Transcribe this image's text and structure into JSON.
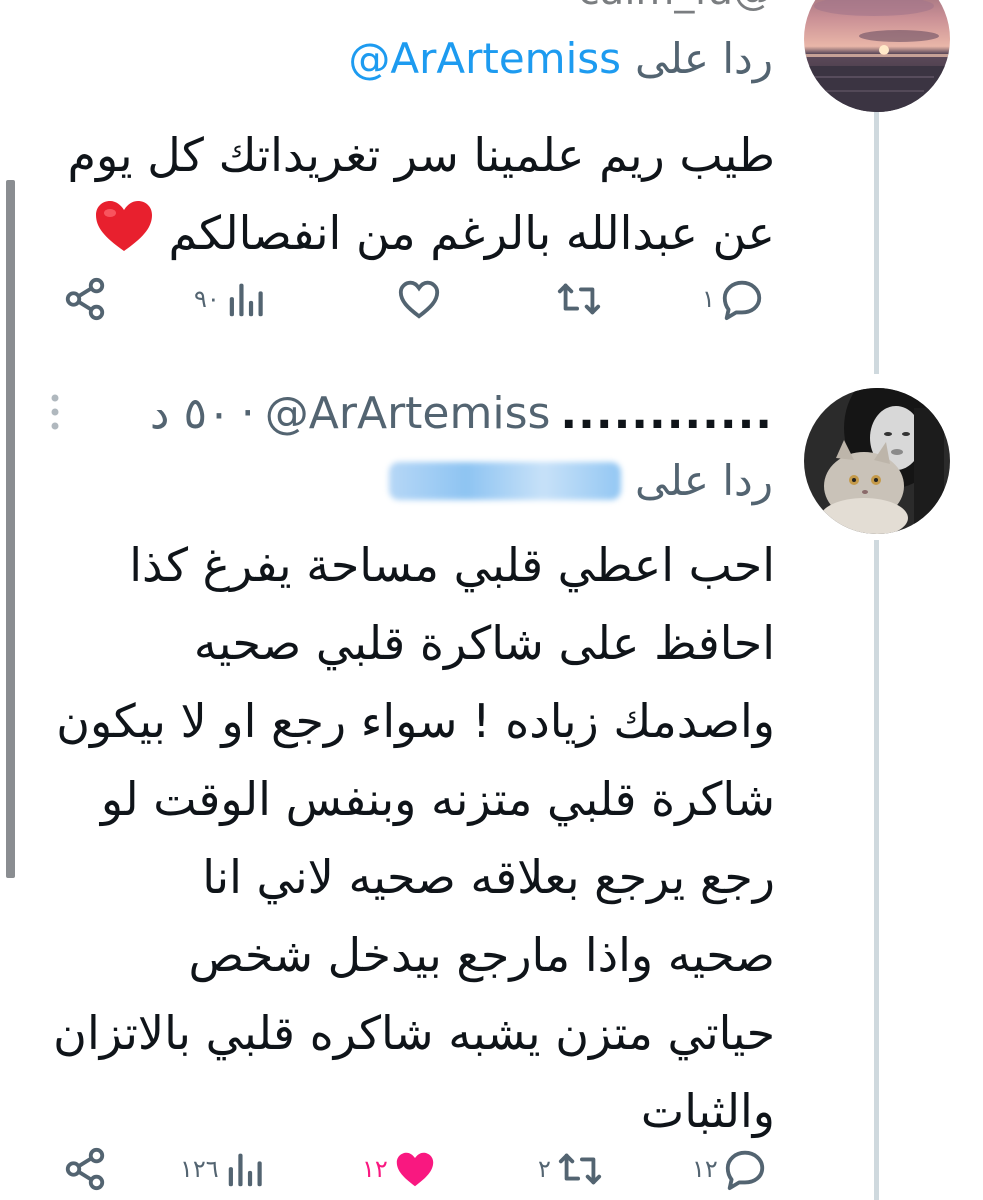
{
  "tweet1": {
    "previous_handle": "@calm_fa",
    "reply_prefix": "ردا على",
    "reply_handle": "@ArArtemiss",
    "body_lines": [
      "طيب ريم علمينا سر تغريداتك كل يوم",
      "عن عبدالله بالرغم من انفصالكم"
    ],
    "emoji": "red-heart-emoji",
    "actions": {
      "reply_count": "١",
      "retweet_count": "",
      "like_count": "",
      "views_count": "٩٠",
      "icons": [
        "reply-icon",
        "retweet-icon",
        "like-icon",
        "views-icon",
        "share-icon"
      ]
    }
  },
  "tweet2": {
    "display_name": "............",
    "handle": "@ArArtemiss",
    "separator": "·",
    "time": "٥٠ د",
    "reply_prefix": "ردا على",
    "reply_handle_blurred": true,
    "body_lines": [
      "احب اعطي قلبي مساحة يفرغ كذا",
      "احافظ على شاكرة قلبي صحيه",
      "واصدمك زياده ! سواء رجع او لا بيكون",
      "شاكرة قلبي متزنه وبنفس الوقت لو",
      "رجع يرجع بعلاقه صحيه لاني انا",
      "صحيه واذا مارجع بيدخل شخص",
      "حياتي متزن يشبه شاكره قلبي بالاتزان",
      "والثبات"
    ],
    "actions": {
      "reply_count": "١٢",
      "retweet_count": "٢",
      "like_count": "١٢",
      "liked": true,
      "views_count": "١٢٦",
      "icons": [
        "reply-icon",
        "retweet-icon",
        "like-icon",
        "views-icon",
        "share-icon"
      ]
    }
  },
  "colors": {
    "accent": "#1d9bf0",
    "muted": "#536471",
    "like": "#f91880",
    "thread_line": "#cfd9de"
  }
}
